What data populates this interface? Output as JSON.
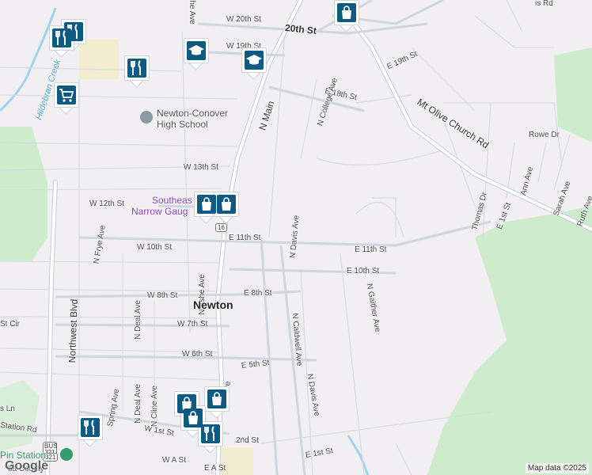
{
  "streets": {
    "w20th": "W 20th St",
    "st20th": "20th St",
    "e19th": "E 19th St",
    "w19th": "W 19th St",
    "e18th": "E 18th St",
    "w13th": "W 13th St",
    "w12th": "W 12th St",
    "e11th": "E 11th St",
    "e11th_east": "E 11th St",
    "w10th": "W 10th St",
    "e10th": "E 10th St",
    "w8th": "W 8th St",
    "e8th": "E 8th St",
    "w7th": "W 7th St",
    "w6th": "W 6th St",
    "e5th": "E 5th St",
    "w1st": "W 1st St",
    "e1st": "E 1st St",
    "e1st_ne": "E 1st St",
    "e2nd": "2nd St",
    "wa": "W A St",
    "ea": "E A St",
    "st_cir": "St Cir",
    "ln": "s Ln",
    "rowe": "Rowe Dr",
    "mt_olive": "Mt Olive Church Rd",
    "n_main": "N Main",
    "n_main_s": "ve",
    "n_college": "N College Ave",
    "n_davis": "N Davis Ave",
    "n_davis_s": "N Davis Ave",
    "n_caldwell": "N Caldwell Ave",
    "n_gaither": "N Gaither Ave",
    "n_ashe_top": "N Ashe Ave",
    "n_ashe": "N Ashe Ave",
    "n_frye": "N Frye Ave",
    "n_deal": "N Deal Ave",
    "n_deal_s": "N Deal Ave",
    "n_cline": "N Cline Ave",
    "spring": "Spring Ave",
    "northwest": "Northwest Blvd",
    "thomas": "Thomas Dr",
    "ann": "Ann Ave",
    "sarah": "Sarah Ave",
    "ruth": "Ruth Ave",
    "davis_rd": "is Rd",
    "station": "Station Rd",
    "county": "ba County"
  },
  "places": {
    "city": "Newton",
    "school_line1": "Newton-Conover",
    "school_line2": "High School",
    "southeast_line1": "Southeas",
    "southeast_line2": "Narrow Gaug",
    "creek": "Hildebran Creek",
    "pin_station": "Pin Station"
  },
  "shields": {
    "route_16": "16",
    "bus_top": "BUS",
    "bus_num": "321",
    "us_321": "321"
  },
  "branding": {
    "logo": "Google",
    "attribution": "Map data ©2025"
  },
  "colors": {
    "background": "#f1eff2",
    "park": "#cdeccc",
    "water": "#9fd4ef",
    "road": "#ffffff",
    "road_outline": "#c7ced6",
    "pin_icon": "#0e5a80"
  },
  "markers": [
    {
      "icon": "restaurant-icon"
    },
    {
      "icon": "restaurant-icon"
    },
    {
      "icon": "shopping-bag-icon"
    },
    {
      "icon": "graduation-cap-icon"
    },
    {
      "icon": "restaurant-icon"
    },
    {
      "icon": "graduation-cap-icon"
    },
    {
      "icon": "shopping-cart-icon"
    },
    {
      "icon": "shopping-bag-icon"
    },
    {
      "icon": "shopping-bag-icon"
    },
    {
      "icon": "shopping-bag-icon"
    },
    {
      "icon": "shopping-bag-icon"
    },
    {
      "icon": "shopping-bag-icon"
    },
    {
      "icon": "restaurant-icon"
    },
    {
      "icon": "restaurant-icon"
    }
  ]
}
